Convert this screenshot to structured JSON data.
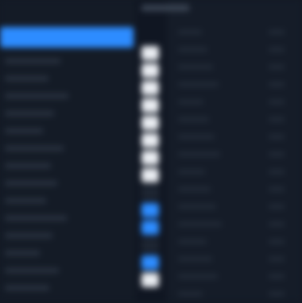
{
  "colors": {
    "background": "#131a25",
    "accent": "#2d8cff",
    "white_indicator": "#e9ecf1",
    "row_divider": "#1c2430"
  },
  "left_list": {
    "selected_index": 0,
    "row_count": 14
  },
  "indicator_column": {
    "items": [
      {
        "state": "white"
      },
      {
        "state": "white"
      },
      {
        "state": "white"
      },
      {
        "state": "white"
      },
      {
        "state": "white"
      },
      {
        "state": "white"
      },
      {
        "state": "white"
      },
      {
        "state": "white"
      },
      {
        "state": "dark"
      },
      {
        "state": "blue"
      },
      {
        "state": "blue"
      },
      {
        "state": "dark"
      },
      {
        "state": "blue"
      },
      {
        "state": "white"
      }
    ]
  }
}
